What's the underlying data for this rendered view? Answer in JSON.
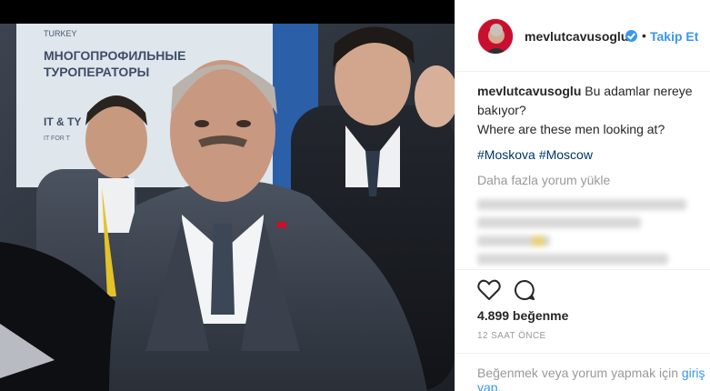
{
  "post": {
    "username": "mevlutcavusoglu",
    "verified_icon": "verified-badge-icon",
    "separator": "•",
    "follow_label": "Takip Et",
    "caption_line1": "Bu adamlar nereye bakıyor?",
    "caption_line2": "Where are these men looking at?",
    "hashtags": [
      "#Moskova",
      "#Moscow"
    ],
    "load_more": "Daha fazla yorum yükle",
    "likes": "4.899 beğenme",
    "time": "12 SAAT ÖNCE"
  },
  "actions": {
    "like_icon": "heart-icon",
    "comment_icon": "comment-bubble-icon"
  },
  "footer": {
    "prompt": "Beğenmek veya yorum yapmak için ",
    "login_link": "giriş yap."
  },
  "photo": {
    "sign_line1": "TURKEY",
    "sign_line2": "МНОГОПРОФИЛЬНЫЕ",
    "sign_line3": "ТУРОПЕРАТОРЫ",
    "sign_line4": "IT & TY",
    "sign_line5": "IT FOR T"
  },
  "colors": {
    "accent": "#3897f0",
    "hashtag": "#003569",
    "muted": "#999999",
    "text": "#262626"
  }
}
